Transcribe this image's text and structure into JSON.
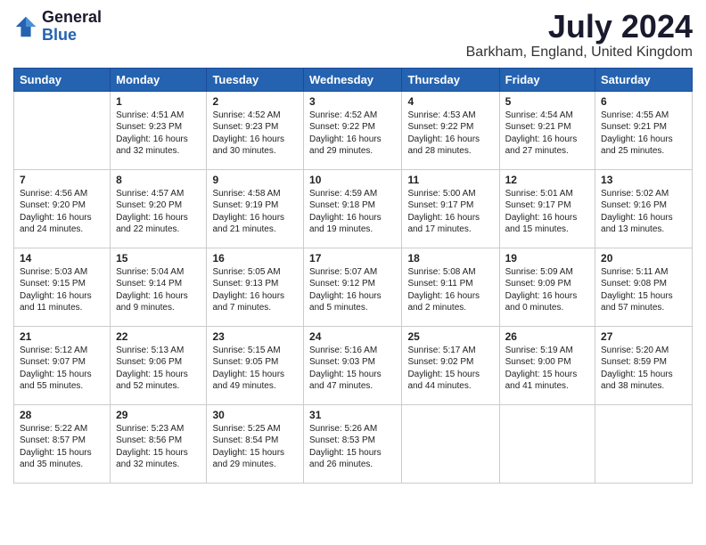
{
  "logo": {
    "general": "General",
    "blue": "Blue"
  },
  "header": {
    "month_year": "July 2024",
    "location": "Barkham, England, United Kingdom"
  },
  "weekdays": [
    "Sunday",
    "Monday",
    "Tuesday",
    "Wednesday",
    "Thursday",
    "Friday",
    "Saturday"
  ],
  "weeks": [
    [
      {
        "day": "",
        "info": ""
      },
      {
        "day": "1",
        "info": "Sunrise: 4:51 AM\nSunset: 9:23 PM\nDaylight: 16 hours\nand 32 minutes."
      },
      {
        "day": "2",
        "info": "Sunrise: 4:52 AM\nSunset: 9:23 PM\nDaylight: 16 hours\nand 30 minutes."
      },
      {
        "day": "3",
        "info": "Sunrise: 4:52 AM\nSunset: 9:22 PM\nDaylight: 16 hours\nand 29 minutes."
      },
      {
        "day": "4",
        "info": "Sunrise: 4:53 AM\nSunset: 9:22 PM\nDaylight: 16 hours\nand 28 minutes."
      },
      {
        "day": "5",
        "info": "Sunrise: 4:54 AM\nSunset: 9:21 PM\nDaylight: 16 hours\nand 27 minutes."
      },
      {
        "day": "6",
        "info": "Sunrise: 4:55 AM\nSunset: 9:21 PM\nDaylight: 16 hours\nand 25 minutes."
      }
    ],
    [
      {
        "day": "7",
        "info": "Sunrise: 4:56 AM\nSunset: 9:20 PM\nDaylight: 16 hours\nand 24 minutes."
      },
      {
        "day": "8",
        "info": "Sunrise: 4:57 AM\nSunset: 9:20 PM\nDaylight: 16 hours\nand 22 minutes."
      },
      {
        "day": "9",
        "info": "Sunrise: 4:58 AM\nSunset: 9:19 PM\nDaylight: 16 hours\nand 21 minutes."
      },
      {
        "day": "10",
        "info": "Sunrise: 4:59 AM\nSunset: 9:18 PM\nDaylight: 16 hours\nand 19 minutes."
      },
      {
        "day": "11",
        "info": "Sunrise: 5:00 AM\nSunset: 9:17 PM\nDaylight: 16 hours\nand 17 minutes."
      },
      {
        "day": "12",
        "info": "Sunrise: 5:01 AM\nSunset: 9:17 PM\nDaylight: 16 hours\nand 15 minutes."
      },
      {
        "day": "13",
        "info": "Sunrise: 5:02 AM\nSunset: 9:16 PM\nDaylight: 16 hours\nand 13 minutes."
      }
    ],
    [
      {
        "day": "14",
        "info": "Sunrise: 5:03 AM\nSunset: 9:15 PM\nDaylight: 16 hours\nand 11 minutes."
      },
      {
        "day": "15",
        "info": "Sunrise: 5:04 AM\nSunset: 9:14 PM\nDaylight: 16 hours\nand 9 minutes."
      },
      {
        "day": "16",
        "info": "Sunrise: 5:05 AM\nSunset: 9:13 PM\nDaylight: 16 hours\nand 7 minutes."
      },
      {
        "day": "17",
        "info": "Sunrise: 5:07 AM\nSunset: 9:12 PM\nDaylight: 16 hours\nand 5 minutes."
      },
      {
        "day": "18",
        "info": "Sunrise: 5:08 AM\nSunset: 9:11 PM\nDaylight: 16 hours\nand 2 minutes."
      },
      {
        "day": "19",
        "info": "Sunrise: 5:09 AM\nSunset: 9:09 PM\nDaylight: 16 hours\nand 0 minutes."
      },
      {
        "day": "20",
        "info": "Sunrise: 5:11 AM\nSunset: 9:08 PM\nDaylight: 15 hours\nand 57 minutes."
      }
    ],
    [
      {
        "day": "21",
        "info": "Sunrise: 5:12 AM\nSunset: 9:07 PM\nDaylight: 15 hours\nand 55 minutes."
      },
      {
        "day": "22",
        "info": "Sunrise: 5:13 AM\nSunset: 9:06 PM\nDaylight: 15 hours\nand 52 minutes."
      },
      {
        "day": "23",
        "info": "Sunrise: 5:15 AM\nSunset: 9:05 PM\nDaylight: 15 hours\nand 49 minutes."
      },
      {
        "day": "24",
        "info": "Sunrise: 5:16 AM\nSunset: 9:03 PM\nDaylight: 15 hours\nand 47 minutes."
      },
      {
        "day": "25",
        "info": "Sunrise: 5:17 AM\nSunset: 9:02 PM\nDaylight: 15 hours\nand 44 minutes."
      },
      {
        "day": "26",
        "info": "Sunrise: 5:19 AM\nSunset: 9:00 PM\nDaylight: 15 hours\nand 41 minutes."
      },
      {
        "day": "27",
        "info": "Sunrise: 5:20 AM\nSunset: 8:59 PM\nDaylight: 15 hours\nand 38 minutes."
      }
    ],
    [
      {
        "day": "28",
        "info": "Sunrise: 5:22 AM\nSunset: 8:57 PM\nDaylight: 15 hours\nand 35 minutes."
      },
      {
        "day": "29",
        "info": "Sunrise: 5:23 AM\nSunset: 8:56 PM\nDaylight: 15 hours\nand 32 minutes."
      },
      {
        "day": "30",
        "info": "Sunrise: 5:25 AM\nSunset: 8:54 PM\nDaylight: 15 hours\nand 29 minutes."
      },
      {
        "day": "31",
        "info": "Sunrise: 5:26 AM\nSunset: 8:53 PM\nDaylight: 15 hours\nand 26 minutes."
      },
      {
        "day": "",
        "info": ""
      },
      {
        "day": "",
        "info": ""
      },
      {
        "day": "",
        "info": ""
      }
    ]
  ]
}
